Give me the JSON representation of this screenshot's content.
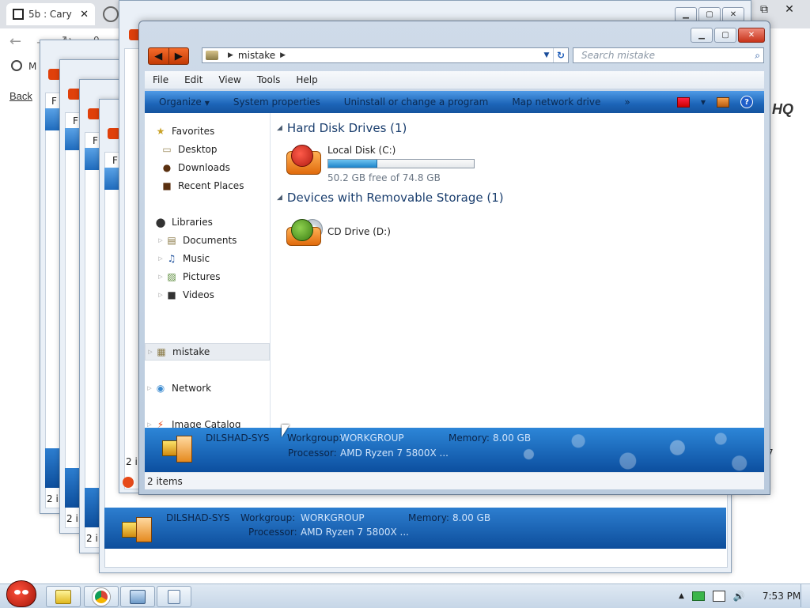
{
  "browser": {
    "tab_title": "5b : Cary",
    "tab_close": "✕",
    "back_link": "Back",
    "hq_text": "HQ",
    "bookmark_initial": "M",
    "address_partial": "0"
  },
  "back_windows": {
    "menu_letter": "F",
    "items_partial": "2 i",
    "details": {
      "computer_name": "DILSHAD-SYS",
      "workgroup_label": "Workgroup:",
      "workgroup_value": "WORKGROUP",
      "memory_label": "Memory:",
      "memory_value": "8.00 GB",
      "processor_label": "Processor:",
      "processor_value": "AMD Ryzen 7 5800X ..."
    },
    "side_number": "7"
  },
  "window": {
    "title_buttons": {
      "minimize": "▁",
      "maximize": "▢",
      "close": "✕"
    },
    "nav": {
      "back": "◀",
      "forward": "▶"
    },
    "address": {
      "separator": "▶",
      "path": "mistake"
    },
    "search": {
      "placeholder": "Search mistake"
    },
    "menu": [
      "File",
      "Edit",
      "View",
      "Tools",
      "Help"
    ],
    "commands": [
      "Organize",
      "System properties",
      "Uninstall or change a program",
      "Map network drive"
    ],
    "commands_more": "»",
    "nav_pane": {
      "favorites": "Favorites",
      "favorites_items": [
        "Desktop",
        "Downloads",
        "Recent Places"
      ],
      "libraries": "Libraries",
      "libraries_items": [
        "Documents",
        "Music",
        "Pictures",
        "Videos"
      ],
      "computer": "mistake",
      "network": "Network",
      "catalog": "Image Catalog"
    },
    "groups": {
      "hdd_header": "Hard Disk Drives (1)",
      "removable_header": "Devices with Removable Storage (1)"
    },
    "drives": {
      "c_name": "Local Disk (C:)",
      "c_free": "50.2 GB free of 74.8 GB",
      "c_used_fraction": 0.329,
      "d_name": "CD Drive (D:)"
    },
    "details": {
      "computer_name": "DILSHAD-SYS",
      "workgroup_label": "Workgroup:",
      "workgroup_value": "WORKGROUP",
      "memory_label": "Memory:",
      "memory_value": "8.00 GB",
      "processor_label": "Processor:",
      "processor_value": "AMD Ryzen 7 5800X ..."
    },
    "status": "2 items"
  },
  "taskbar": {
    "clock": "7:53 PM",
    "tray_up": "▲",
    "volume": "🔊"
  }
}
